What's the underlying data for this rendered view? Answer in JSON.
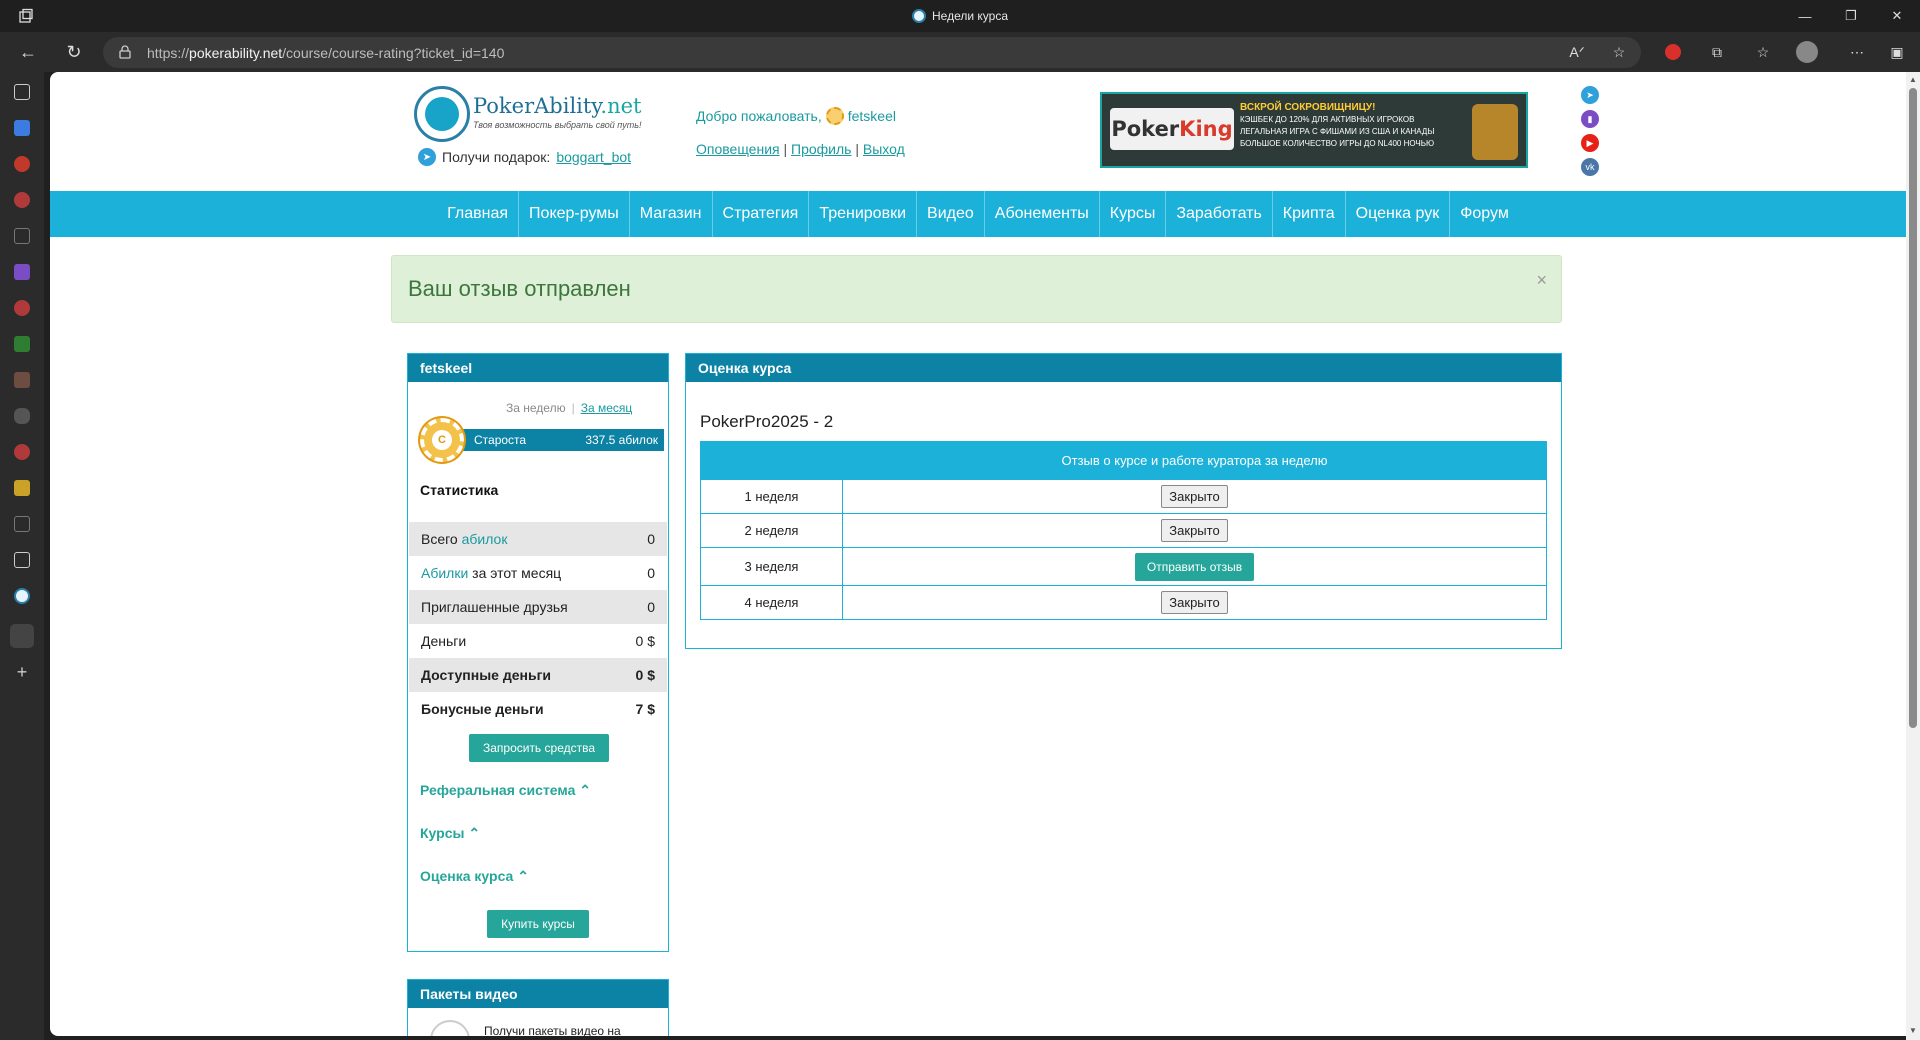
{
  "browser": {
    "window_title": "Недели курса",
    "url_prefix": "https://",
    "url_host": "pokerability.net",
    "url_path": "/course/course-rating?ticket_id=140"
  },
  "header": {
    "logo_name": "PokerAbility",
    "logo_tld": ".net",
    "logo_tagline": "Твоя возможность выбрать свой путь!",
    "gift_label": "Получи подарок:",
    "gift_link": "boggart_bot",
    "welcome_label": "Добро пожаловать,",
    "username": "fetskeel",
    "links": [
      "Оповещения",
      "Профиль",
      "Выход"
    ],
    "banner": {
      "brand_a": "Poker",
      "brand_b": "King",
      "headline": "ВСКРОЙ СОКРОВИЩНИЦУ!",
      "lines": [
        "КЭШБЕК ДО 120% ДЛЯ АКТИВНЫХ ИГРОКОВ",
        "ЛЕГАЛЬНАЯ ИГРА С ФИШАМИ ИЗ США И КАНАДЫ",
        "БОЛЬШОЕ КОЛИЧЕСТВО ИГРЫ ДО NL400 НОЧЬЮ"
      ]
    }
  },
  "nav": [
    "Главная",
    "Покер-румы",
    "Магазин",
    "Стратегия",
    "Тренировки",
    "Видео",
    "Абонементы",
    "Курсы",
    "Заработать",
    "Крипта",
    "Оценка рук",
    "Форум"
  ],
  "alert": {
    "message": "Ваш отзыв отправлен",
    "close": "×"
  },
  "profile": {
    "username": "fetskeel",
    "period_week": "За неделю",
    "period_month": "За месяц",
    "rank_letter": "C",
    "rank_name": "Староста",
    "rank_value": "337.5 абилок",
    "stats_title": "Статистика",
    "stats": [
      {
        "pre": "Всего ",
        "link": "абилок",
        "post": "",
        "value": "0"
      },
      {
        "pre": "",
        "link": "Абилки",
        "post": " за этот месяц",
        "value": "0"
      },
      {
        "pre": "Приглашенные друзья",
        "link": "",
        "post": "",
        "value": "0"
      },
      {
        "pre": "Деньги",
        "link": "",
        "post": "",
        "value": "0 $"
      },
      {
        "pre": "Доступные деньги",
        "link": "",
        "post": "",
        "value": "0 $"
      },
      {
        "pre": "Бонусные деньги",
        "link": "",
        "post": "",
        "value": "7 $"
      }
    ],
    "request_button": "Запросить средства",
    "sections": [
      "Реферальная система",
      "Курсы",
      "Оценка курса"
    ],
    "buy_button": "Купить курсы"
  },
  "rating": {
    "panel_title": "Оценка курса",
    "course_name": "PokerPro2025 - 2",
    "column_header": "Отзыв о курсе и работе куратора за неделю",
    "weeks": [
      {
        "week": "1 неделя",
        "action": "Закрыто",
        "status": "closed"
      },
      {
        "week": "2 неделя",
        "action": "Закрыто",
        "status": "closed"
      },
      {
        "week": "3 неделя",
        "action": "Отправить отзыв",
        "status": "open"
      },
      {
        "week": "4 неделя",
        "action": "Закрыто",
        "status": "closed"
      }
    ]
  },
  "video_packs": {
    "title": "Пакеты видео",
    "text": "Получи пакеты видео на"
  },
  "colors": {
    "nav": "#1bb1d8",
    "panel_header": "#0c82a4",
    "teal": "#26a69a",
    "alert_bg": "#dff0d8"
  }
}
